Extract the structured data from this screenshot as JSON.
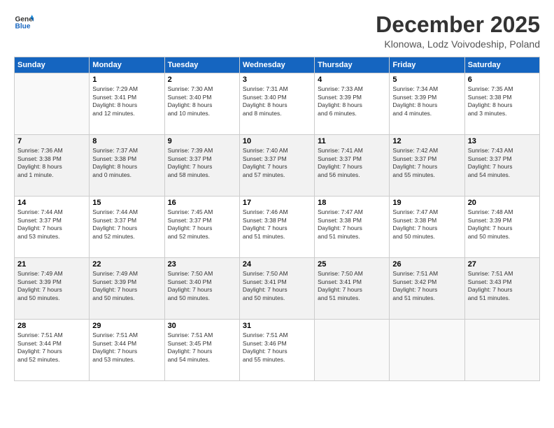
{
  "logo": {
    "line1": "General",
    "line2": "Blue"
  },
  "title": "December 2025",
  "location": "Klonowa, Lodz Voivodeship, Poland",
  "days_header": [
    "Sunday",
    "Monday",
    "Tuesday",
    "Wednesday",
    "Thursday",
    "Friday",
    "Saturday"
  ],
  "weeks": [
    [
      {
        "day": "",
        "info": ""
      },
      {
        "day": "1",
        "info": "Sunrise: 7:29 AM\nSunset: 3:41 PM\nDaylight: 8 hours\nand 12 minutes."
      },
      {
        "day": "2",
        "info": "Sunrise: 7:30 AM\nSunset: 3:40 PM\nDaylight: 8 hours\nand 10 minutes."
      },
      {
        "day": "3",
        "info": "Sunrise: 7:31 AM\nSunset: 3:40 PM\nDaylight: 8 hours\nand 8 minutes."
      },
      {
        "day": "4",
        "info": "Sunrise: 7:33 AM\nSunset: 3:39 PM\nDaylight: 8 hours\nand 6 minutes."
      },
      {
        "day": "5",
        "info": "Sunrise: 7:34 AM\nSunset: 3:39 PM\nDaylight: 8 hours\nand 4 minutes."
      },
      {
        "day": "6",
        "info": "Sunrise: 7:35 AM\nSunset: 3:38 PM\nDaylight: 8 hours\nand 3 minutes."
      }
    ],
    [
      {
        "day": "7",
        "info": "Sunrise: 7:36 AM\nSunset: 3:38 PM\nDaylight: 8 hours\nand 1 minute."
      },
      {
        "day": "8",
        "info": "Sunrise: 7:37 AM\nSunset: 3:38 PM\nDaylight: 8 hours\nand 0 minutes."
      },
      {
        "day": "9",
        "info": "Sunrise: 7:39 AM\nSunset: 3:37 PM\nDaylight: 7 hours\nand 58 minutes."
      },
      {
        "day": "10",
        "info": "Sunrise: 7:40 AM\nSunset: 3:37 PM\nDaylight: 7 hours\nand 57 minutes."
      },
      {
        "day": "11",
        "info": "Sunrise: 7:41 AM\nSunset: 3:37 PM\nDaylight: 7 hours\nand 56 minutes."
      },
      {
        "day": "12",
        "info": "Sunrise: 7:42 AM\nSunset: 3:37 PM\nDaylight: 7 hours\nand 55 minutes."
      },
      {
        "day": "13",
        "info": "Sunrise: 7:43 AM\nSunset: 3:37 PM\nDaylight: 7 hours\nand 54 minutes."
      }
    ],
    [
      {
        "day": "14",
        "info": "Sunrise: 7:44 AM\nSunset: 3:37 PM\nDaylight: 7 hours\nand 53 minutes."
      },
      {
        "day": "15",
        "info": "Sunrise: 7:44 AM\nSunset: 3:37 PM\nDaylight: 7 hours\nand 52 minutes."
      },
      {
        "day": "16",
        "info": "Sunrise: 7:45 AM\nSunset: 3:37 PM\nDaylight: 7 hours\nand 52 minutes."
      },
      {
        "day": "17",
        "info": "Sunrise: 7:46 AM\nSunset: 3:38 PM\nDaylight: 7 hours\nand 51 minutes."
      },
      {
        "day": "18",
        "info": "Sunrise: 7:47 AM\nSunset: 3:38 PM\nDaylight: 7 hours\nand 51 minutes."
      },
      {
        "day": "19",
        "info": "Sunrise: 7:47 AM\nSunset: 3:38 PM\nDaylight: 7 hours\nand 50 minutes."
      },
      {
        "day": "20",
        "info": "Sunrise: 7:48 AM\nSunset: 3:39 PM\nDaylight: 7 hours\nand 50 minutes."
      }
    ],
    [
      {
        "day": "21",
        "info": "Sunrise: 7:49 AM\nSunset: 3:39 PM\nDaylight: 7 hours\nand 50 minutes."
      },
      {
        "day": "22",
        "info": "Sunrise: 7:49 AM\nSunset: 3:39 PM\nDaylight: 7 hours\nand 50 minutes."
      },
      {
        "day": "23",
        "info": "Sunrise: 7:50 AM\nSunset: 3:40 PM\nDaylight: 7 hours\nand 50 minutes."
      },
      {
        "day": "24",
        "info": "Sunrise: 7:50 AM\nSunset: 3:41 PM\nDaylight: 7 hours\nand 50 minutes."
      },
      {
        "day": "25",
        "info": "Sunrise: 7:50 AM\nSunset: 3:41 PM\nDaylight: 7 hours\nand 51 minutes."
      },
      {
        "day": "26",
        "info": "Sunrise: 7:51 AM\nSunset: 3:42 PM\nDaylight: 7 hours\nand 51 minutes."
      },
      {
        "day": "27",
        "info": "Sunrise: 7:51 AM\nSunset: 3:43 PM\nDaylight: 7 hours\nand 51 minutes."
      }
    ],
    [
      {
        "day": "28",
        "info": "Sunrise: 7:51 AM\nSunset: 3:44 PM\nDaylight: 7 hours\nand 52 minutes."
      },
      {
        "day": "29",
        "info": "Sunrise: 7:51 AM\nSunset: 3:44 PM\nDaylight: 7 hours\nand 53 minutes."
      },
      {
        "day": "30",
        "info": "Sunrise: 7:51 AM\nSunset: 3:45 PM\nDaylight: 7 hours\nand 54 minutes."
      },
      {
        "day": "31",
        "info": "Sunrise: 7:51 AM\nSunset: 3:46 PM\nDaylight: 7 hours\nand 55 minutes."
      },
      {
        "day": "",
        "info": ""
      },
      {
        "day": "",
        "info": ""
      },
      {
        "day": "",
        "info": ""
      }
    ]
  ]
}
